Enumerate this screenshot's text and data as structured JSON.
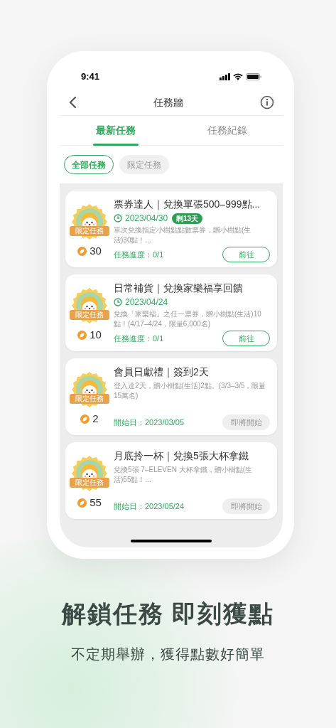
{
  "status_bar": {
    "time": "9:41"
  },
  "nav": {
    "title": "任務牆"
  },
  "tabs": [
    {
      "label": "最新任務",
      "selected": true
    },
    {
      "label": "任務紀錄",
      "selected": false
    }
  ],
  "filters": [
    {
      "label": "全部任務",
      "selected": true
    },
    {
      "label": "限定任務",
      "selected": false
    }
  ],
  "tasks": [
    {
      "kind": "active",
      "badge": "限定任務",
      "points": "30",
      "title": "票券達人｜兌換單張500–999點...",
      "date": "2023/04/30",
      "remaining": "剩13天",
      "description": "單次兌換指定小樹點點數票券，贈小樹點(生活)30點！...",
      "footer": "任務進度：0/1",
      "button": "前往"
    },
    {
      "kind": "active",
      "badge": "限定任務",
      "points": "10",
      "title": "日常補貨｜兌換家樂福享回饋",
      "date": "2023/04/24",
      "description": "兌換「家樂福」之任一票券，贈小樹點(生活)10點！(4/17–4/24，限量6,000名)",
      "footer": "任務進度：0/1",
      "button": "前往"
    },
    {
      "kind": "upcoming",
      "badge": "限定任務",
      "points": "2",
      "title": "會員日獻禮｜簽到2天",
      "description": "登入達2天，贈小樹點(生活)2點。(3/3–3/5，限量15萬名)",
      "footer": "開始日：2023/03/05",
      "button": "即將開始"
    },
    {
      "kind": "upcoming",
      "badge": "限定任務",
      "points": "55",
      "title": "月底拎一杯｜兌換5張大杯拿鐵",
      "description": "兌換5張 7–ELEVEN 大杯拿鐵，贈小樹點(生活)55點！...",
      "footer": "開始日：2023/05/24",
      "button": "即將開始"
    }
  ],
  "headline": "解鎖任務 即刻獲點",
  "subtitle": "不定期舉辦，獲得點數好簡單"
}
